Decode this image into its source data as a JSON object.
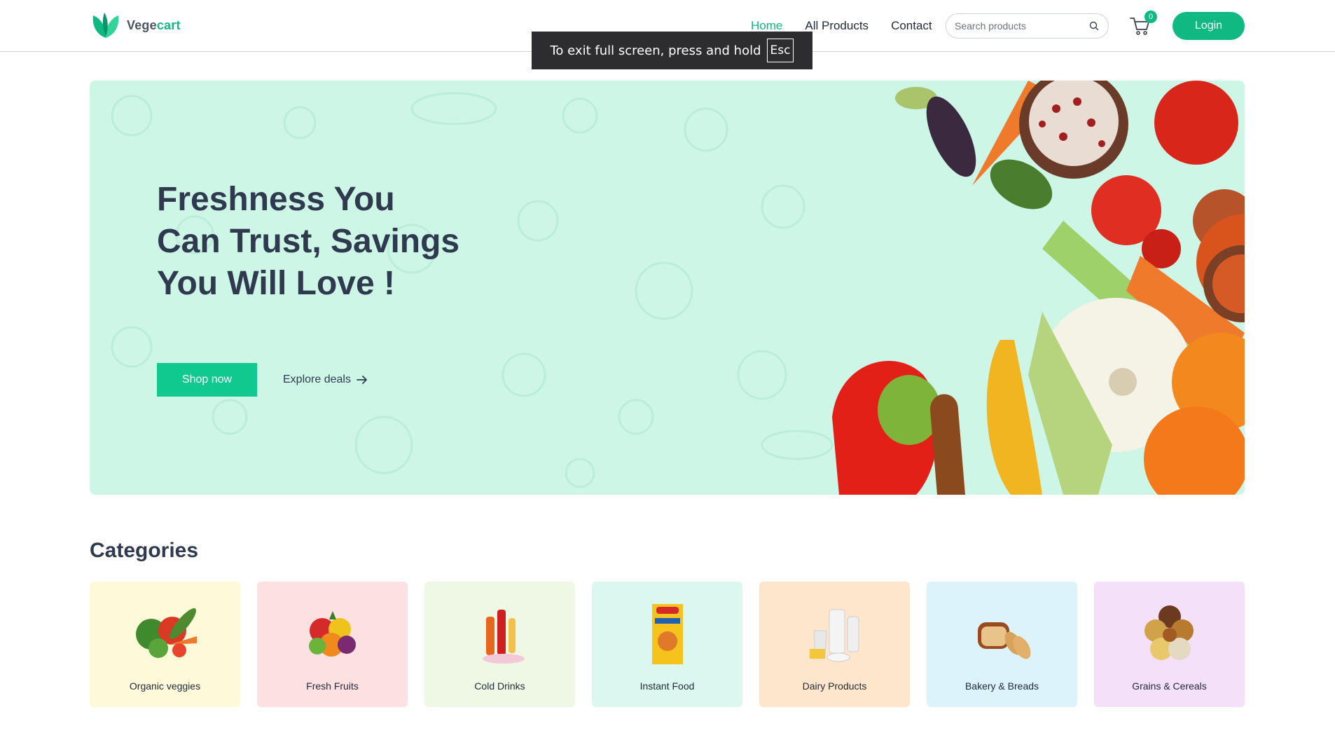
{
  "brand": {
    "name_part1": "Vege",
    "name_part2": "cart",
    "accent": "#10b981"
  },
  "nav": {
    "items": [
      {
        "label": "Home",
        "active": true
      },
      {
        "label": "All Products",
        "active": false
      },
      {
        "label": "Contact",
        "active": false
      }
    ]
  },
  "search": {
    "placeholder": "Search products",
    "icon": "search-icon"
  },
  "cart": {
    "count": "0",
    "icon": "cart-icon"
  },
  "login": {
    "label": "Login"
  },
  "toast": {
    "text": "To exit full screen, press and hold",
    "key": "Esc"
  },
  "hero": {
    "title": "Freshness You Can Trust, Savings You Will Love !",
    "shop_label": "Shop now",
    "explore_label": "Explore deals",
    "background": "#cdf6e7"
  },
  "categories": {
    "title": "Categories",
    "items": [
      {
        "label": "Organic veggies",
        "bg": "#fef9d9"
      },
      {
        "label": "Fresh Fruits",
        "bg": "#fde0e2"
      },
      {
        "label": "Cold Drinks",
        "bg": "#eef8e4"
      },
      {
        "label": "Instant Food",
        "bg": "#dcf7ef"
      },
      {
        "label": "Dairy Products",
        "bg": "#fde6cb"
      },
      {
        "label": "Bakery & Breads",
        "bg": "#dcf3fb"
      },
      {
        "label": "Grains & Cereals",
        "bg": "#f4e0f8"
      }
    ]
  }
}
